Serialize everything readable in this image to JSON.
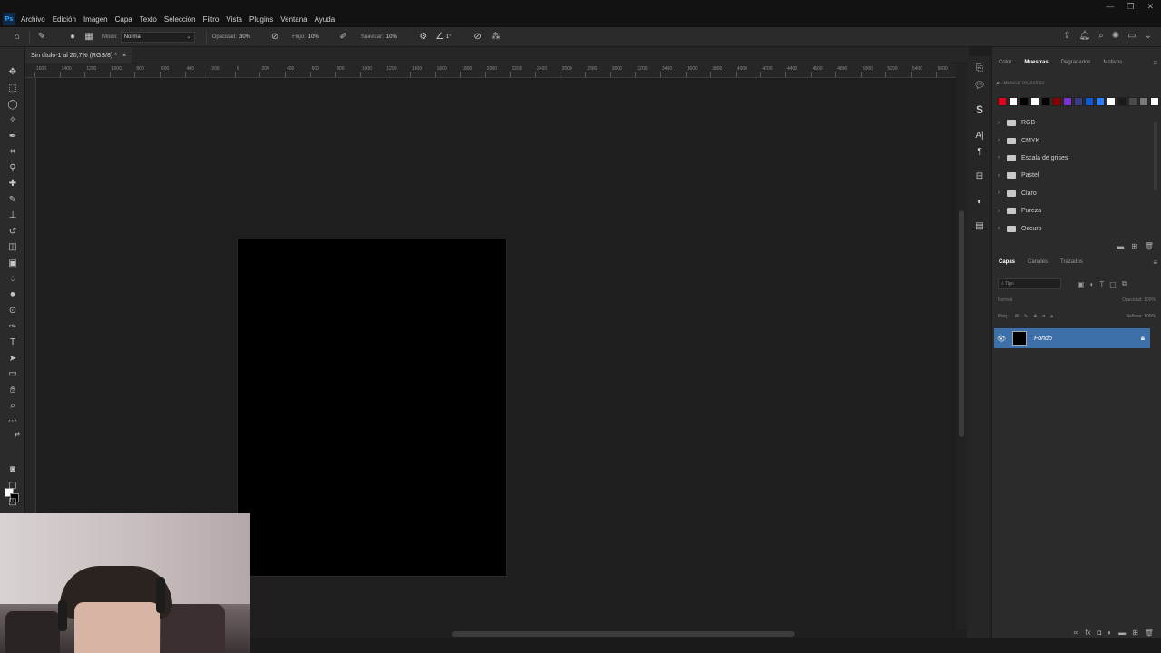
{
  "app": {
    "logo": "Ps",
    "menu": [
      "Archivo",
      "Edición",
      "Imagen",
      "Capa",
      "Texto",
      "Selección",
      "Filtro",
      "Vista",
      "Plugins",
      "Ventana",
      "Ayuda"
    ],
    "window_controls": [
      "—",
      "❐",
      "✕"
    ]
  },
  "options": {
    "mode_label": "Modo:",
    "mode_value": "Normal",
    "opacity_label": "Opacidad:",
    "opacity_value": "30%",
    "flow_label": "Flujo:",
    "flow_value": "10%",
    "smoothing_label": "Suavizar:",
    "smoothing_value": "10%",
    "angle_value": "1°"
  },
  "document": {
    "tab_title": "Sin título-1 al 20,7% (RGB/8) *",
    "close": "×",
    "canvas_color": "#000000"
  },
  "rulers": {
    "h_ticks": [
      "1600",
      "1400",
      "1200",
      "1000",
      "800",
      "600",
      "400",
      "200",
      "0",
      "200",
      "400",
      "600",
      "800",
      "1000",
      "1200",
      "1400",
      "1600",
      "1800",
      "2000",
      "2200",
      "2400",
      "2600",
      "2800",
      "3000",
      "3200",
      "3400",
      "3600",
      "3800",
      "4000",
      "4200",
      "4400",
      "4600",
      "4800",
      "5000",
      "5200",
      "5400",
      "5600"
    ]
  },
  "swatches_panel": {
    "tabs": [
      "Color",
      "Muestras",
      "Degradados",
      "Motivos"
    ],
    "active_tab": "Muestras",
    "search_placeholder": "Buscar muestras",
    "recent_colors": [
      "#e8001c",
      "#ffffff",
      "#000000",
      "#ffffff",
      "#000000",
      "#8b0000",
      "#7b2fd6",
      "#3a3a8a",
      "#0a5bd6",
      "#2a7fff",
      "#ffffff",
      "#1a1a1a",
      "#4a4a4a",
      "#7a7a7a",
      "#ffffff"
    ],
    "groups": [
      "RGB",
      "CMYK",
      "Escala de grises",
      "Pastel",
      "Claro",
      "Pureza",
      "Oscuro"
    ]
  },
  "layers_panel": {
    "tabs": [
      "Capas",
      "Canales",
      "Trazados"
    ],
    "active_tab": "Capas",
    "filter_placeholder": "Tipo",
    "blend_mode": "Normal",
    "opacity_label": "Opacidad:",
    "opacity_value": "100%",
    "lock_label": "Bloq.:",
    "fill_label": "Relleno:",
    "fill_value": "100%",
    "layers": [
      {
        "name": "Fondo",
        "visible": true,
        "locked": true,
        "thumb_color": "#000000"
      }
    ]
  },
  "colors": {
    "accent": "#3d6fa8",
    "app_bg": "#1e1e1e",
    "panel_bg": "#2b2b2b"
  }
}
